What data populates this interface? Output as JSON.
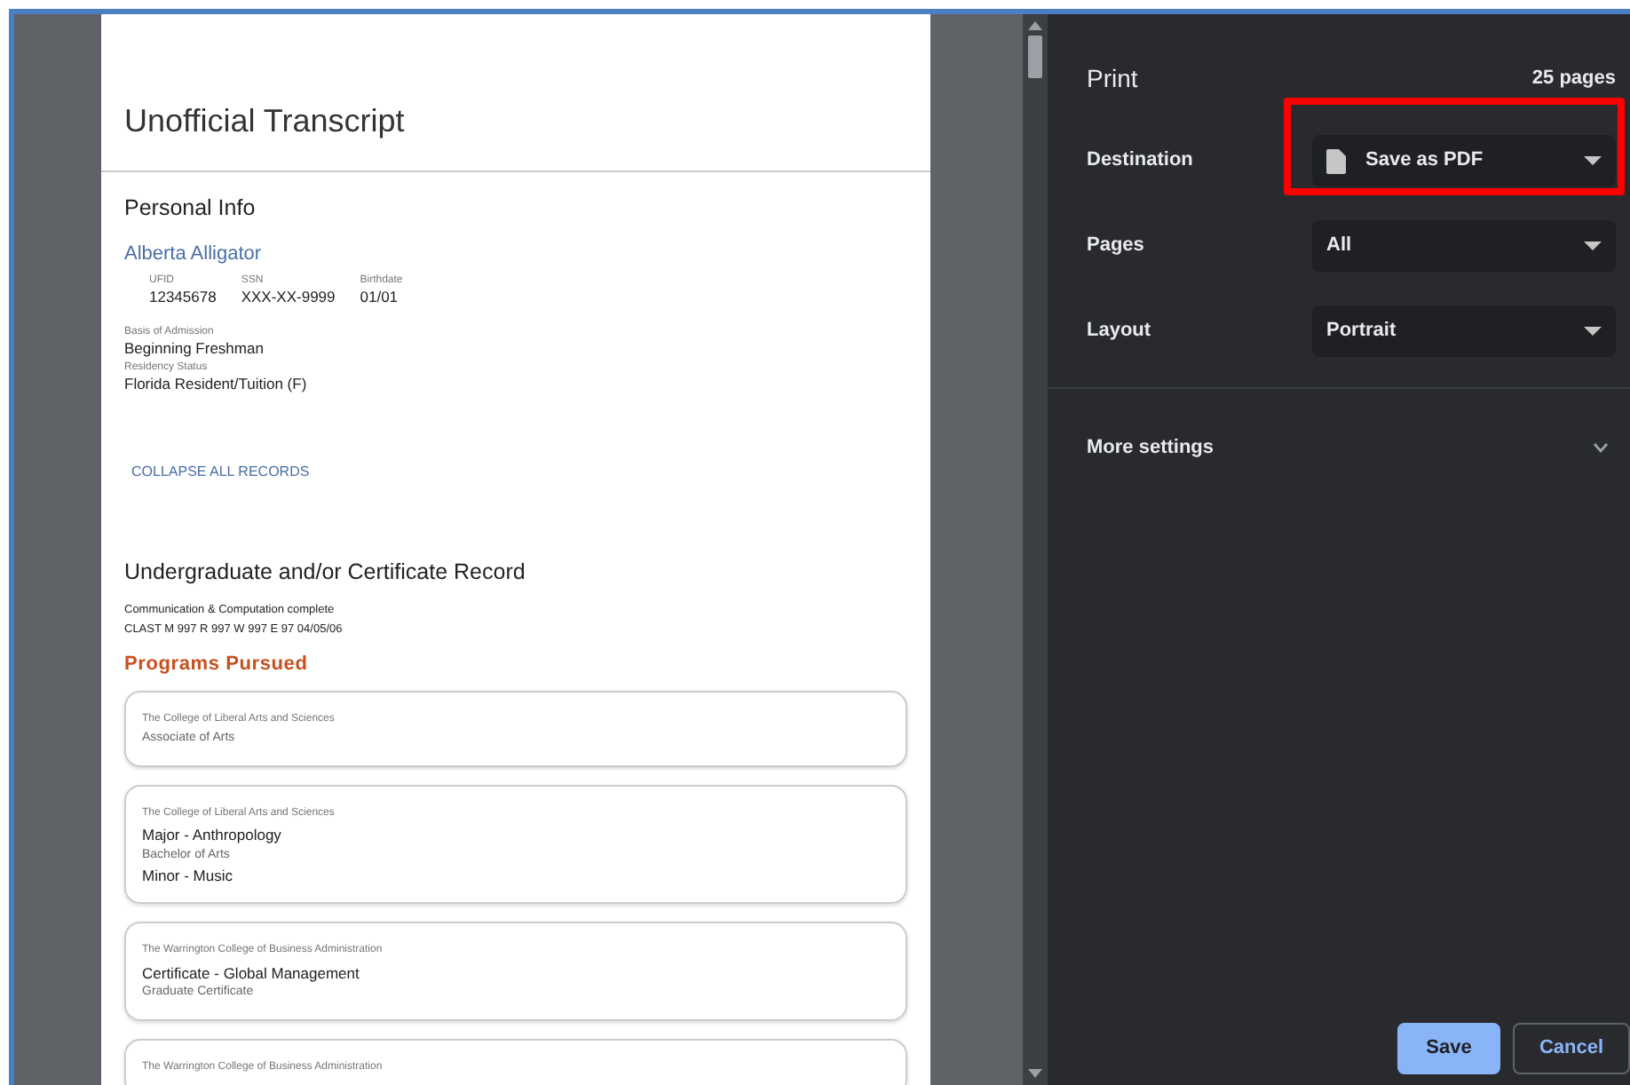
{
  "document": {
    "title": "Unofficial Transcript",
    "personal_info": {
      "heading": "Personal Info",
      "name": "Alberta Alligator",
      "ids": [
        {
          "label": "UFID",
          "value": "12345678"
        },
        {
          "label": "SSN",
          "value": "XXX-XX-9999"
        },
        {
          "label": "Birthdate",
          "value": "01/01"
        }
      ],
      "fields": [
        {
          "label": "Basis of Admission",
          "value": "Beginning Freshman"
        },
        {
          "label": "Residency Status",
          "value": "Florida Resident/Tuition (F)"
        }
      ]
    },
    "collapse_link": "COLLAPSE ALL RECORDS",
    "record": {
      "heading": "Undergraduate and/or Certificate Record",
      "notes": [
        "Communication & Computation complete",
        "CLAST M 997 R 997 W 997 E 97 04/05/06"
      ],
      "programs_heading": "Programs Pursued",
      "programs": [
        {
          "lines": [
            {
              "kind": "college",
              "text": "The College of Liberal Arts and Sciences"
            },
            {
              "kind": "degree",
              "text": "Associate of Arts"
            }
          ]
        },
        {
          "lines": [
            {
              "kind": "college",
              "text": "The College of Liberal Arts and Sciences"
            },
            {
              "kind": "major",
              "text": "Major - Anthropology"
            },
            {
              "kind": "degree",
              "text": "Bachelor of Arts"
            },
            {
              "kind": "major",
              "text": "Minor - Music"
            }
          ]
        },
        {
          "lines": [
            {
              "kind": "college",
              "text": "The Warrington College of Business Administration"
            },
            {
              "kind": "major",
              "text": "Certificate - Global Management"
            },
            {
              "kind": "degree",
              "text": "Graduate Certificate"
            }
          ]
        },
        {
          "lines": [
            {
              "kind": "college",
              "text": "The Warrington College of Business Administration"
            }
          ]
        }
      ]
    }
  },
  "print_panel": {
    "title": "Print",
    "page_count": "25 pages",
    "settings": [
      {
        "label": "Destination",
        "value": "Save as PDF",
        "has_file_icon": true,
        "highlighted": true
      },
      {
        "label": "Pages",
        "value": "All",
        "has_file_icon": false,
        "highlighted": false
      },
      {
        "label": "Layout",
        "value": "Portrait",
        "has_file_icon": false,
        "highlighted": false
      }
    ],
    "more_settings": {
      "label": "More settings",
      "expanded": false
    },
    "buttons": [
      {
        "label": "Save",
        "kind": "primary"
      },
      {
        "label": "Cancel",
        "kind": "secondary"
      }
    ]
  }
}
